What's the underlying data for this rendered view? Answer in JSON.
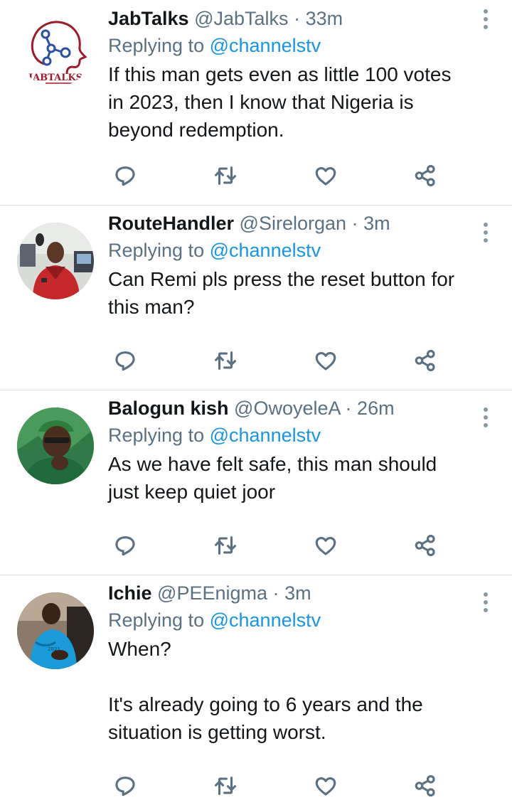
{
  "tweets": [
    {
      "name": "JabTalks",
      "handle": "@JabTalks",
      "separator": "·",
      "time": "33m",
      "replying_prefix": "Replying to",
      "replying_to": "@channelstv",
      "paragraphs": [
        "If this man gets even as little 100 votes in 2023, then I know that Nigeria is beyond redemption."
      ],
      "avatar_logo_text": "JABTALKS"
    },
    {
      "name": "RouteHandler",
      "handle": "@Sirelorgan",
      "separator": "·",
      "time": "3m",
      "replying_prefix": "Replying to",
      "replying_to": "@channelstv",
      "paragraphs": [
        "Can Remi pls press the reset button for this man?"
      ]
    },
    {
      "name": "Balogun kish",
      "handle": "@OwoyeleA",
      "separator": "·",
      "time": "26m",
      "replying_prefix": "Replying to",
      "replying_to": "@channelstv",
      "paragraphs": [
        "As we have felt safe, this man should just keep quiet joor"
      ]
    },
    {
      "name": "Ichie",
      "handle": "@PEEnigma",
      "separator": "·",
      "time": "3m",
      "replying_prefix": "Replying to",
      "replying_to": "@channelstv",
      "paragraphs": [
        "When?",
        "It's already going to 6 years and the situation is getting worst."
      ]
    }
  ],
  "icons": {
    "reply": "reply-icon",
    "retweet": "retweet-icon",
    "like": "like-icon",
    "share": "share-icon",
    "more": "more-options-icon"
  },
  "colors": {
    "text": "#14171a",
    "secondary": "#5b7083",
    "mention": "#1b95e0",
    "divider": "#dcdfe2"
  }
}
